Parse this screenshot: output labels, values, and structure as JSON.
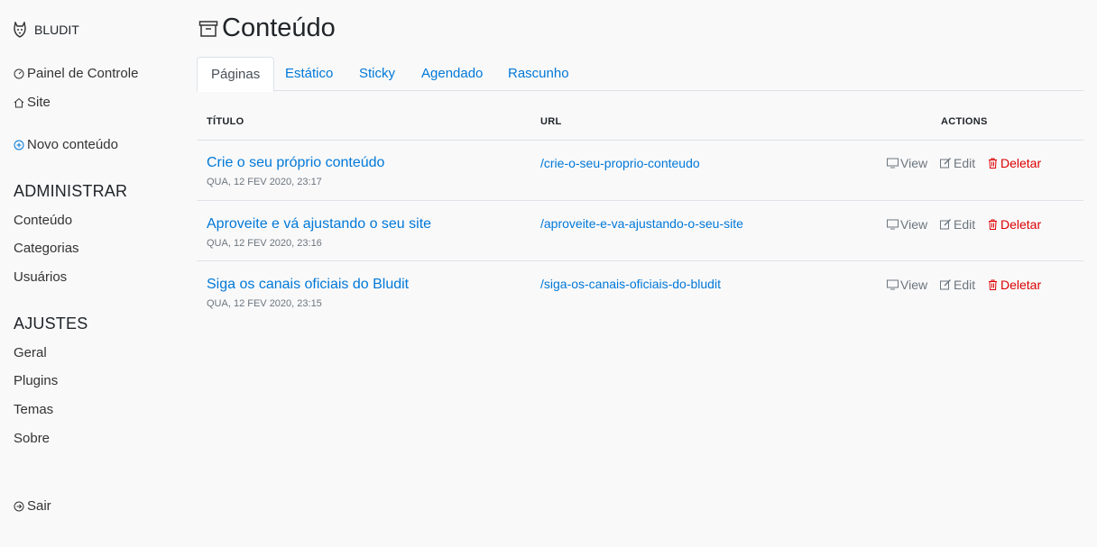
{
  "sidebar": {
    "brand": "BLUDIT",
    "links_top": [
      {
        "label": "Painel de Controle",
        "icon": "dashboard-icon"
      },
      {
        "label": "Site",
        "icon": "home-icon"
      }
    ],
    "new_content": {
      "label": "Novo conteúdo",
      "icon": "plus-circle-icon"
    },
    "section_admin": "ADMINISTRAR",
    "admin_items": [
      "Conteúdo",
      "Categorias",
      "Usuários"
    ],
    "section_settings": "AJUSTES",
    "settings_items": [
      "Geral",
      "Plugins",
      "Temas",
      "Sobre"
    ],
    "logout": {
      "label": "Sair",
      "icon": "logout-icon"
    }
  },
  "page": {
    "title": "Conteúdo",
    "icon": "archive-icon"
  },
  "tabs": [
    "Páginas",
    "Estático",
    "Sticky",
    "Agendado",
    "Rascunho"
  ],
  "active_tab": "Páginas",
  "table": {
    "headers": {
      "title": "TÍTULO",
      "url": "URL",
      "actions": "ACTIONS"
    },
    "rows": [
      {
        "title": "Crie o seu próprio conteúdo",
        "date": "QUA, 12 FEV 2020, 23:17",
        "url": "/crie-o-seu-proprio-conteudo"
      },
      {
        "title": "Aproveite e vá ajustando o seu site",
        "date": "QUA, 12 FEV 2020, 23:16",
        "url": "/aproveite-e-va-ajustando-o-seu-site"
      },
      {
        "title": "Siga os canais oficiais do Bludit",
        "date": "QUA, 12 FEV 2020, 23:15",
        "url": "/siga-os-canais-oficiais-do-bludit"
      }
    ],
    "actions": {
      "view": "View",
      "edit": "Edit",
      "delete": "Deletar"
    }
  },
  "colors": {
    "link": "#0078d7",
    "danger": "#dc0000",
    "muted": "#6c757d",
    "background": "#f9f9fa"
  }
}
